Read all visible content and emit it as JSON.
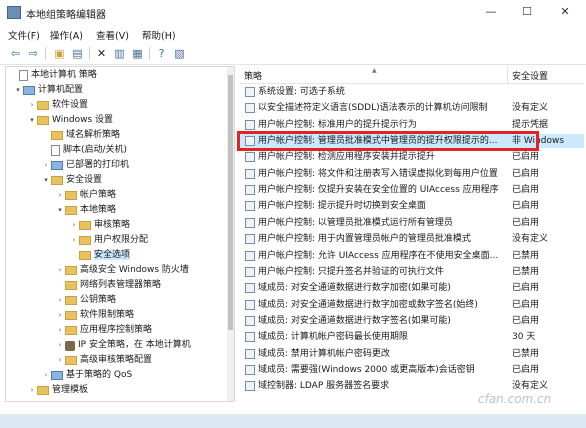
{
  "window": {
    "title": "本地组策略编辑器",
    "controls": {
      "minimize": "—",
      "maximize": "☐",
      "close": "✕"
    }
  },
  "menu": [
    "文件(F)",
    "操作(A)",
    "查看(V)",
    "帮助(H)"
  ],
  "toolbar": [
    {
      "icon": "back-arrow-icon",
      "glyph": "⇦"
    },
    {
      "icon": "forward-arrow-icon",
      "glyph": "⇨"
    },
    {
      "icon": "up-folder-icon",
      "glyph": "▣"
    },
    {
      "icon": "show-tree-icon",
      "glyph": "▤"
    },
    {
      "icon": "delete-icon",
      "glyph": "✕"
    },
    {
      "icon": "properties-icon",
      "glyph": "▥"
    },
    {
      "icon": "export-list-icon",
      "glyph": "▦"
    },
    {
      "icon": "help-icon",
      "glyph": "?"
    },
    {
      "icon": "view-icon",
      "glyph": "▧"
    }
  ],
  "tree": [
    {
      "label": "本地计算机 策略",
      "icon": "policy-doc-icon",
      "expander": ""
    },
    {
      "label": "计算机配置",
      "icon": "computer-icon",
      "expander": "▾"
    },
    {
      "label": "软件设置",
      "icon": "folder-icon",
      "expander": "›"
    },
    {
      "label": "Windows 设置",
      "icon": "folder-icon",
      "expander": "▾"
    },
    {
      "label": "域名解析策略",
      "icon": "folder-icon",
      "expander": ""
    },
    {
      "label": "脚本(启动/关机)",
      "icon": "script-doc-icon",
      "expander": ""
    },
    {
      "label": "已部署的打印机",
      "icon": "printer-icon",
      "expander": "›"
    },
    {
      "label": "安全设置",
      "icon": "security-icon",
      "expander": "▾"
    },
    {
      "label": "帐户策略",
      "icon": "folder-icon",
      "expander": "›"
    },
    {
      "label": "本地策略",
      "icon": "folder-icon",
      "expander": "▾"
    },
    {
      "label": "审核策略",
      "icon": "folder-icon",
      "expander": "›"
    },
    {
      "label": "用户权限分配",
      "icon": "folder-icon",
      "expander": "›"
    },
    {
      "label": "安全选项",
      "icon": "folder-icon",
      "expander": "",
      "selected": true
    },
    {
      "label": "高级安全 Windows 防火墙",
      "icon": "folder-icon",
      "expander": "›"
    },
    {
      "label": "网络列表管理器策略",
      "icon": "folder-icon",
      "expander": ""
    },
    {
      "label": "公钥策略",
      "icon": "folder-icon",
      "expander": "›"
    },
    {
      "label": "软件限制策略",
      "icon": "folder-icon",
      "expander": "›"
    },
    {
      "label": "应用程序控制策略",
      "icon": "folder-icon",
      "expander": "›"
    },
    {
      "label": "IP 安全策略，在 本地计算机",
      "icon": "ip-policy-icon",
      "expander": "›"
    },
    {
      "label": "高级审核策略配置",
      "icon": "folder-icon",
      "expander": "›"
    },
    {
      "label": "基于策略的 QoS",
      "icon": "qos-chart-icon",
      "expander": "›"
    },
    {
      "label": "管理模板",
      "icon": "folder-icon",
      "expander": "›"
    }
  ],
  "columns": {
    "policy": "策略",
    "setting": "安全设置"
  },
  "policies": [
    {
      "name": "系统设置: 可选子系统",
      "setting": ""
    },
    {
      "name": "以安全描述符定义语言(SDDL)语法表示的计算机访问限制",
      "setting": "没有定义"
    },
    {
      "name": "用户帐户控制: 标准用户的提升提示行为",
      "setting": "提示凭据"
    },
    {
      "name": "用户帐户控制: 管理员批准模式中管理员的提升权限提示的...",
      "setting": "非 Windows",
      "highlighted": true
    },
    {
      "name": "用户帐户控制: 检测应用程序安装并提示提升",
      "setting": "已启用"
    },
    {
      "name": "用户帐户控制: 将文件和注册表写入错误虚拟化到每用户位置",
      "setting": "已启用"
    },
    {
      "name": "用户帐户控制: 仅提升安装在安全位置的 UIAccess 应用程序",
      "setting": "已启用"
    },
    {
      "name": "用户帐户控制: 提示提升时切换到安全桌面",
      "setting": "已启用"
    },
    {
      "name": "用户帐户控制: 以管理员批准模式运行所有管理员",
      "setting": "已启用"
    },
    {
      "name": "用户帐户控制: 用于内置管理员帐户的管理员批准模式",
      "setting": "没有定义"
    },
    {
      "name": "用户帐户控制: 允许 UIAccess 应用程序在不使用安全桌面...",
      "setting": "已禁用"
    },
    {
      "name": "用户帐户控制: 只提升签名并验证的可执行文件",
      "setting": "已禁用"
    },
    {
      "name": "域成员: 对安全通道数据进行数字加密(如果可能)",
      "setting": "已启用"
    },
    {
      "name": "域成员: 对安全通道数据进行数字加密或数字签名(始终)",
      "setting": "已启用"
    },
    {
      "name": "域成员: 对安全通道数据进行数字签名(如果可能)",
      "setting": "已启用"
    },
    {
      "name": "域成员: 计算机帐户密码最长使用期限",
      "setting": "30 天"
    },
    {
      "name": "域成员: 禁用计算机帐户密码更改",
      "setting": "已禁用"
    },
    {
      "name": "域成员: 需要强(Windows 2000 或更高版本)会话密钥",
      "setting": "已启用"
    },
    {
      "name": "域控制器: LDAP 服务器签名要求",
      "setting": "没有定义"
    }
  ],
  "watermark": "cfan.com.cn"
}
